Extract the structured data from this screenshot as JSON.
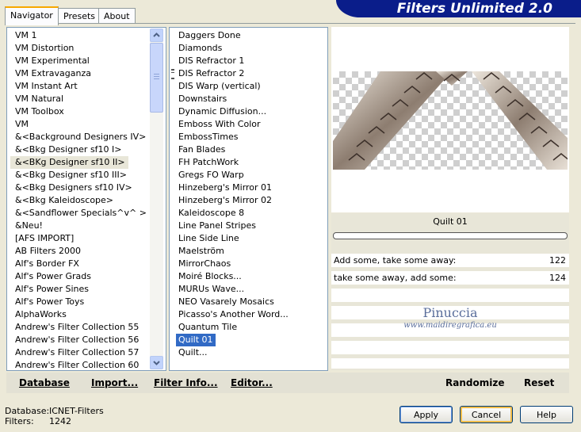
{
  "tabs": [
    "Navigator",
    "Presets",
    "About"
  ],
  "banner": "Filters Unlimited 2.0",
  "categories": [
    "VM 1",
    "VM Distortion",
    "VM Experimental",
    "VM Extravaganza",
    "VM Instant Art",
    "VM Natural",
    "VM Toolbox",
    "VM",
    "&<Background Designers IV>",
    "&<Bkg Designer sf10 I>",
    "&<BKg Designer sf10 II>",
    "&<Bkg Designer sf10 III>",
    "&<Bkg Designers sf10 IV>",
    "&<Bkg Kaleidoscope>",
    "&<Sandflower Specials^v^ >",
    "&Neu!",
    "[AFS IMPORT]",
    "AB Filters 2000",
    "Alf's Border FX",
    "Alf's Power Grads",
    "Alf's Power Sines",
    "Alf's Power Toys",
    "AlphaWorks",
    "Andrew's Filter Collection 55",
    "Andrew's Filter Collection 56",
    "Andrew's Filter Collection 57",
    "Andrew's Filter Collection 60"
  ],
  "filters": [
    "Daggers Done",
    "Diamonds",
    "DIS Refractor 1",
    "DIS Refractor 2",
    "DIS Warp (vertical)",
    "Downstairs",
    "Dynamic Diffusion...",
    "Emboss With Color",
    "EmbossTimes",
    "Fan Blades",
    "FH PatchWork",
    "Gregs FO Warp",
    "Hinzeberg's Mirror 01",
    "Hinzeberg's Mirror 02",
    "Kaleidoscope 8",
    "Line Panel Stripes",
    "Line Side Line",
    "Maelström",
    "MirrorChaos",
    "Moiré Blocks...",
    "MURUs Wave...",
    "NEO Vasarely Mosaics",
    "Picasso's Another Word...",
    "Quantum Tile",
    "Quilt 01",
    "Quilt..."
  ],
  "selected_category": "&<BKg Designer sf10 II>",
  "selected_filter": "Quilt 01",
  "filter_name": "Quilt 01",
  "params": [
    {
      "label": "Add some, take some away:",
      "value": "122"
    },
    {
      "label": "take some away, add some:",
      "value": "124"
    }
  ],
  "watermark": {
    "name": "Pinuccia",
    "url": "www.maidiregrafica.eu"
  },
  "bottom_links": {
    "database": "Database",
    "import": "Import...",
    "filter_info": "Filter Info...",
    "editor": "Editor...",
    "randomize": "Randomize",
    "reset": "Reset"
  },
  "status": {
    "db_label": "Database:",
    "db_value": "ICNET-Filters",
    "filters_label": "Filters:",
    "filters_value": "1242"
  },
  "buttons": {
    "apply": "Apply",
    "cancel": "Cancel",
    "help": "Help"
  },
  "colors": {
    "selection": "#316ac5",
    "banner": "#0a1d8a"
  }
}
